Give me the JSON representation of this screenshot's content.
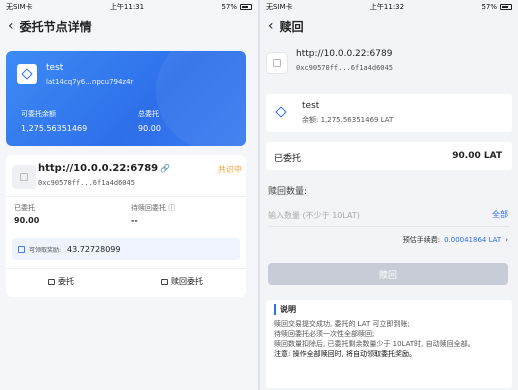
{
  "left": {
    "status": {
      "carrier": "无SIM卡",
      "time": "上午11:31",
      "battery": "57%"
    },
    "nav_title": "委托节点详情",
    "asset_card": {
      "name": "test",
      "address": "lat14cq7y6...npcu794z4r",
      "available_label": "可委托余额",
      "available_value": "1,275.56351469",
      "total_label": "总委托",
      "total_value": "90.00"
    },
    "node": {
      "url": "http://10.0.0.22:6789",
      "status": "共识中",
      "hash": "0xc90570ff...6f1a4d6045",
      "delegated_label": "已委托",
      "delegated_value": "90.00",
      "pending_label": "待赎回委托",
      "pending_value": "--",
      "reward_label": "可领取奖励:",
      "reward_value": "43.72728099",
      "action_delegate": "委托",
      "action_redeem": "赎回委托"
    }
  },
  "right": {
    "status": {
      "carrier": "无SIM卡",
      "time": "上午11:32",
      "battery": "57%"
    },
    "nav_title": "赎回",
    "node": {
      "url": "http://10.0.0.22:6789",
      "hash": "0xc90570ff...6f1a4d6045"
    },
    "token": {
      "name": "test",
      "balance": "余额: 1,275.56351469 LAT"
    },
    "delegated": {
      "label": "已委托",
      "value": "90.00 LAT"
    },
    "amount_title": "赎回数量:",
    "amount_placeholder": "输入数量 (不少于 10LAT)",
    "all_label": "全部",
    "fee_label": "预估手续费:",
    "fee_value": "0.00041864 LAT",
    "submit_label": "赎回",
    "note": {
      "title": "说明",
      "lines": [
        "赎回交易提交成功, 委托的 LAT 可立即到账;",
        "待赎回委托必须一次性全部赎回;",
        "赎回数量扣除后, 已委托剩余数量少于 10LAT时, 自动赎回全部。",
        "注意: 操作全部赎回时, 将自动领取委托奖励。"
      ]
    }
  }
}
